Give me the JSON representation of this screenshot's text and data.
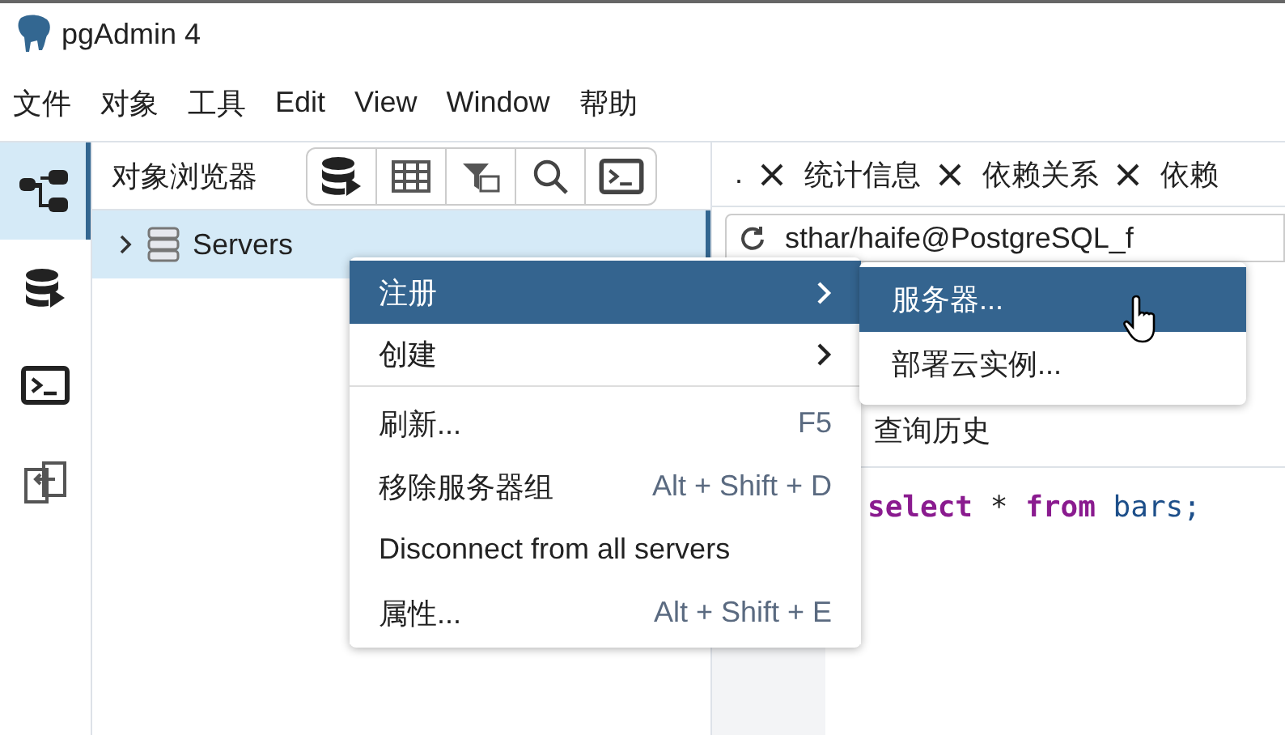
{
  "window": {
    "title": "pgAdmin 4"
  },
  "menu_bar": [
    "文件",
    "对象",
    "工具",
    "Edit",
    "View",
    "Window",
    "帮助"
  ],
  "activity_bar": [
    {
      "kind": "tree",
      "selected": true
    },
    {
      "kind": "database",
      "selected": false
    },
    {
      "kind": "terminal",
      "selected": false
    },
    {
      "kind": "compare",
      "selected": false
    }
  ],
  "object_browser": {
    "title": "对象浏览器",
    "tree": [
      {
        "label": "Servers",
        "expanded": false,
        "selected": true
      }
    ]
  },
  "tabs": [
    {
      "label": ".",
      "selected": false
    },
    {
      "label": "统计信息",
      "selected": false
    },
    {
      "label": "依赖关系",
      "selected": false
    },
    {
      "label": "依赖",
      "selected": false
    }
  ],
  "connection": "sthar/haife@PostgreSQL_f",
  "query_history_label": "查询历史",
  "editor": {
    "keyword_1": "select",
    "operator": "*",
    "keyword_2": "from",
    "identifier": "bars;"
  },
  "context_menu": [
    {
      "label": "注册",
      "kind": "submenu",
      "selected": true,
      "divider_after": false
    },
    {
      "label": "创建",
      "kind": "submenu",
      "selected": false,
      "divider_after": true
    },
    {
      "label": "刷新...",
      "kind": "action",
      "shortcut": "F5",
      "selected": false,
      "divider_after": false
    },
    {
      "label": "移除服务器组",
      "kind": "action",
      "shortcut": "Alt + Shift + D",
      "selected": false,
      "divider_after": false
    },
    {
      "label": "Disconnect from all servers",
      "kind": "action",
      "selected": false,
      "divider_after": false
    },
    {
      "label": "属性...",
      "kind": "action",
      "shortcut": "Alt + Shift + E",
      "selected": false,
      "divider_after": false
    }
  ],
  "submenu": [
    {
      "label": "服务器...",
      "selected": true
    },
    {
      "label": "部署云实例...",
      "selected": false
    }
  ]
}
